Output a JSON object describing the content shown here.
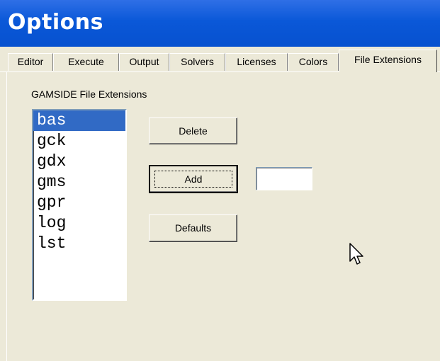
{
  "window": {
    "title": "Options"
  },
  "tabs": [
    {
      "label": "Editor"
    },
    {
      "label": "Execute"
    },
    {
      "label": "Output"
    },
    {
      "label": "Solvers"
    },
    {
      "label": "Licenses"
    },
    {
      "label": "Colors"
    },
    {
      "label": "File Extensions",
      "active": true
    }
  ],
  "extensions_panel": {
    "group_label": "GAMSIDE File Extensions",
    "extensions": [
      "bas",
      "gck",
      "gdx",
      "gms",
      "gpr",
      "log",
      "lst"
    ],
    "selected": "bas",
    "buttons": {
      "delete": "Delete",
      "add": "Add",
      "defaults": "Defaults"
    },
    "new_extension_value": ""
  },
  "colors": {
    "title_bar": "#0a58d8",
    "selection": "#316ac5",
    "background": "#ece9d8"
  },
  "icons": {
    "cursor": "mouse-pointer-arrow"
  }
}
